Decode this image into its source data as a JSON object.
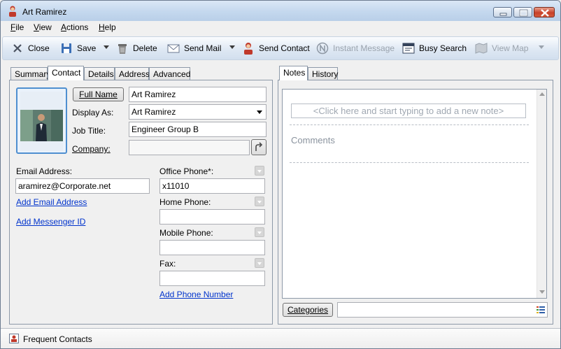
{
  "window": {
    "title": "Art Ramirez"
  },
  "menu": {
    "items": [
      {
        "key": "F",
        "rest": "ile"
      },
      {
        "key": "V",
        "rest": "iew"
      },
      {
        "key": "A",
        "rest": "ctions"
      },
      {
        "key": "H",
        "rest": "elp"
      }
    ]
  },
  "toolbar": {
    "close": "Close",
    "save": "Save",
    "delete": "Delete",
    "send_mail": "Send Mail",
    "send_contact": "Send Contact",
    "instant_message": "Instant Message",
    "busy_search": "Busy Search",
    "view_map": "View Map"
  },
  "tabs_left": [
    "Summary",
    "Contact",
    "Details",
    "Address",
    "Advanced"
  ],
  "tabs_right": [
    "Notes",
    "History"
  ],
  "contact": {
    "full_name_button": "Full Name",
    "full_name_value": "Art Ramirez",
    "display_as_label": "Display As:",
    "display_as_value": "Art Ramirez",
    "job_title_label": "Job Title:",
    "job_title_value": "Engineer Group B",
    "company_label": "Company:",
    "company_value": "",
    "email_label": "Email Address:",
    "email_value": "aramirez@Corporate.net",
    "add_email_link": "Add Email Address",
    "add_messenger_link": "Add Messenger ID",
    "office_phone_label": "Office Phone*:",
    "office_phone_value": "x11010",
    "home_phone_label": "Home Phone:",
    "mobile_phone_label": "Mobile Phone:",
    "fax_label": "Fax:",
    "add_phone_link": "Add Phone Number"
  },
  "notes": {
    "placeholder": "<Click here and start typing to add a new note>",
    "comments": "Comments",
    "categories_button": "Categories"
  },
  "status": {
    "frequent_contacts": "Frequent Contacts"
  }
}
